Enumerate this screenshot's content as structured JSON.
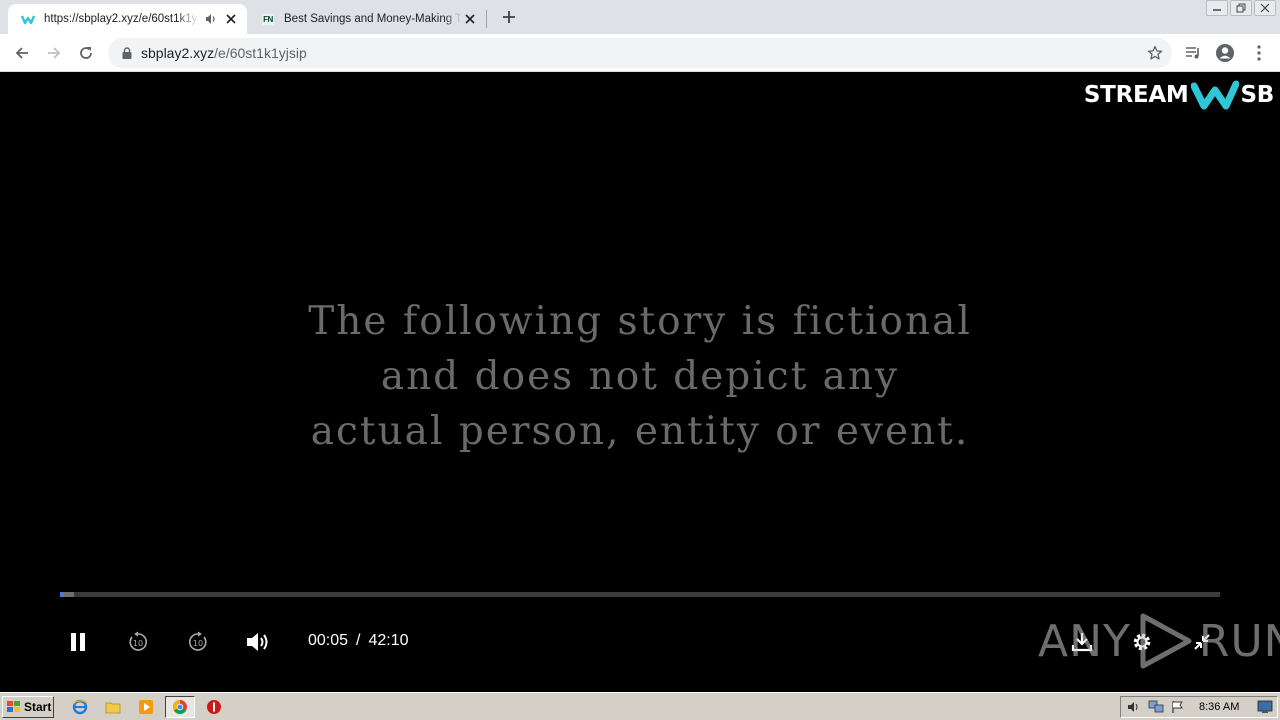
{
  "browser": {
    "tabs": [
      {
        "title": "https://sbplay2.xyz/e/60st1k1yjsip",
        "active": true,
        "audio_playing": true,
        "favicon": "streamsb-icon"
      },
      {
        "title": "Best Savings and Money-Making Tips",
        "active": false,
        "favicon": "fn-icon",
        "favicon_text": "FN"
      }
    ],
    "address_bar": {
      "domain": "sbplay2.xyz",
      "path": "/e/60st1k1yjsip",
      "secure": true
    }
  },
  "player": {
    "logo": {
      "left": "STREAM",
      "right": "SB"
    },
    "story_lines": [
      "The following story is fictional",
      "and does not depict any",
      "actual person, entity or event."
    ],
    "time": {
      "current": "00:05",
      "separator": "/",
      "duration": "42:10"
    },
    "progress_fraction": 0.002,
    "buffered_fraction": 0.012,
    "state": "playing"
  },
  "watermark": {
    "left": "ANY",
    "right": "RUN"
  },
  "taskbar": {
    "start_label": "Start",
    "clock": "8:36 AM"
  },
  "colors": {
    "accent": "#4f79d6",
    "tab_strip": "#dee1e6",
    "streamsb_teal": "#2fc6d6"
  }
}
